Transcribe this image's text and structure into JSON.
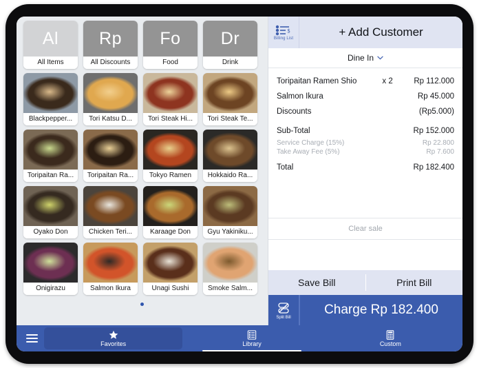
{
  "categories": [
    {
      "abbr": "Al",
      "label": "All Items",
      "color": "#d2d3d5"
    },
    {
      "abbr": "Rp",
      "label": "All Discounts",
      "color": "#949494"
    },
    {
      "abbr": "Fo",
      "label": "Food",
      "color": "#949494"
    },
    {
      "abbr": "Dr",
      "label": "Drink",
      "color": "#949494"
    }
  ],
  "products": [
    {
      "label": "Blackpepper...",
      "c1": "#8e9aa6",
      "c2": "#3a2a1c",
      "c3": "#d9b98a"
    },
    {
      "label": "Tori Katsu D...",
      "c1": "#6e6e6e",
      "c2": "#e0a84f",
      "c3": "#f2cf8d"
    },
    {
      "label": "Tori Steak Hi...",
      "c1": "#c9b89c",
      "c2": "#8e3420",
      "c3": "#edd39a"
    },
    {
      "label": "Tori Steak Te...",
      "c1": "#c2a77f",
      "c2": "#6d4423",
      "c3": "#edca86"
    },
    {
      "label": "Toripaitan Ra...",
      "c1": "#7b6a55",
      "c2": "#3b2a1d",
      "c3": "#c9d98e"
    },
    {
      "label": "Toripaitan Ra...",
      "c1": "#8a6a49",
      "c2": "#2c1d12",
      "c3": "#e8cf96"
    },
    {
      "label": "Tokyo Ramen",
      "c1": "#2a2722",
      "c2": "#b4461f",
      "c3": "#e9d08c"
    },
    {
      "label": "Hokkaido Ra...",
      "c1": "#2b2a28",
      "c2": "#6e4a2a",
      "c3": "#dcc38f"
    },
    {
      "label": "Oyako Don",
      "c1": "#6f6354",
      "c2": "#352a20",
      "c3": "#cfd36b"
    },
    {
      "label": "Chicken Teri...",
      "c1": "#4b443c",
      "c2": "#7a4a22",
      "c3": "#e9e6de"
    },
    {
      "label": "Karaage Don",
      "c1": "#23201d",
      "c2": "#a96a2c",
      "c3": "#cbd77a"
    },
    {
      "label": "Gyu Yakiniku...",
      "c1": "#8c6a45",
      "c2": "#5b3a22",
      "c3": "#bdbd7a"
    },
    {
      "label": "Onigirazu",
      "c1": "#2c2b2c",
      "c2": "#6d2f52",
      "c3": "#cfe09a"
    },
    {
      "label": "Salmon Ikura",
      "c1": "#c79a5c",
      "c2": "#d2542a",
      "c3": "#2f2a26"
    },
    {
      "label": "Unagi Sushi",
      "c1": "#c3a06a",
      "c2": "#5a2f1b",
      "c3": "#e8e2d6"
    },
    {
      "label": "Smoke Salm...",
      "c1": "#cfcfc9",
      "c2": "#e0a472",
      "c3": "#7d5a2e"
    }
  ],
  "pagination": {
    "dots": 1,
    "active": 0
  },
  "order": {
    "billing_list_label": "Billing List",
    "add_customer_label": "+ Add Customer",
    "dine_option": "Dine In",
    "lines": [
      {
        "name": "Toripaitan Ramen Shio",
        "qty": "x 2",
        "amount": "Rp 112.000",
        "muted": false
      },
      {
        "name": "Salmon Ikura",
        "qty": "",
        "amount": "Rp 45.000",
        "muted": false
      },
      {
        "name": "Discounts",
        "qty": "",
        "amount": "(Rp5.000)",
        "muted": false
      }
    ],
    "subtotal_label": "Sub-Total",
    "subtotal_value": "Rp 152.000",
    "charges": [
      {
        "name": "Service Charge (15%)",
        "amount": "Rp 22.800"
      },
      {
        "name": "Take Away Fee (5%)",
        "amount": "Rp 7.600"
      }
    ],
    "total_label": "Total",
    "total_value": "Rp 182.400",
    "clear_sale_label": "Clear sale",
    "save_bill_label": "Save Bill",
    "print_bill_label": "Print Bill",
    "split_bill_label": "Split Bill",
    "charge_label": "Charge Rp 182.400"
  },
  "nav": {
    "favorites_label": "Favorites",
    "library_label": "Library",
    "custom_label": "Custom"
  },
  "colors": {
    "accent_blue": "#3b5cad",
    "nav_active": "#34509b",
    "header_band": "#e0e4f2",
    "screen_bg": "#e9ecef"
  }
}
